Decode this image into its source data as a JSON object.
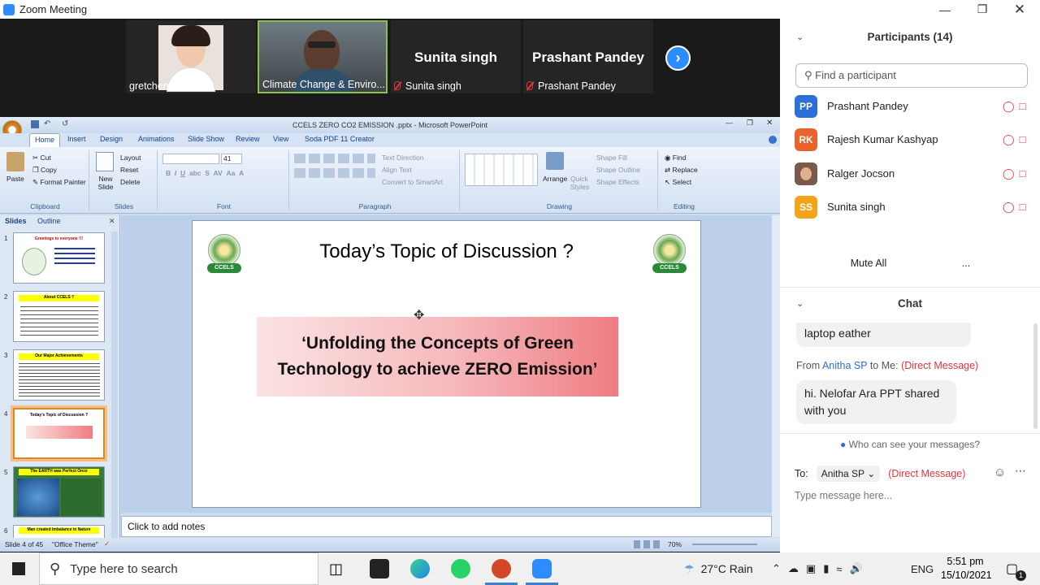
{
  "window": {
    "title": "Zoom Meeting",
    "controls": [
      "minimize-icon",
      "restore-icon",
      "close-icon"
    ]
  },
  "video_strip": {
    "tiles": [
      {
        "name": "gretchen liboon",
        "type": "video",
        "muted": false
      },
      {
        "name": "Climate Change & Enviro...",
        "type": "video",
        "muted": false,
        "active_speaker": true
      },
      {
        "name": "Sunita singh",
        "type": "name",
        "muted": true
      },
      {
        "name": "Prashant Pandey",
        "type": "name",
        "muted": true
      }
    ]
  },
  "powerpoint": {
    "title": "CCELS ZERO CO2 EMISSION .pptx - Microsoft PowerPoint",
    "tabs": [
      "Home",
      "Insert",
      "Design",
      "Animations",
      "Slide Show",
      "Review",
      "View",
      "Soda PDF 11 Creator"
    ],
    "ribbon": {
      "clipboard": {
        "paste": "Paste",
        "cut": "Cut",
        "copy": "Copy",
        "format_painter": "Format Painter",
        "label": "Clipboard"
      },
      "slides": {
        "new_slide": "New Slide",
        "layout": "Layout",
        "reset": "Reset",
        "delete": "Delete",
        "label": "Slides"
      },
      "font": {
        "size": "41",
        "label": "Font"
      },
      "paragraph": {
        "text_direction": "Text Direction",
        "align_text": "Align Text",
        "convert": "Convert to SmartArt",
        "label": "Paragraph"
      },
      "drawing": {
        "arrange": "Arrange",
        "quick_styles": "Quick Styles",
        "shape_fill": "Shape Fill",
        "shape_outline": "Shape Outline",
        "shape_effects": "Shape Effects",
        "label": "Drawing"
      },
      "editing": {
        "find": "Find",
        "replace": "Replace",
        "select": "Select",
        "label": "Editing"
      }
    },
    "panel_tabs": [
      "Slides",
      "Outline"
    ],
    "thumbnails": [
      {
        "num": "1",
        "title": "Greetings to everyone !!!"
      },
      {
        "num": "2",
        "title": "About CCELS ?"
      },
      {
        "num": "3",
        "title": "Our Major Achievements"
      },
      {
        "num": "4",
        "title": "Today's Topic of Discussion ?"
      },
      {
        "num": "5",
        "title": "The EARTH was Perfect Once"
      },
      {
        "num": "6",
        "title": "Man created Imbalance in Nature"
      }
    ],
    "slide": {
      "title": "Today’s Topic of Discussion ?",
      "logo_text": "CCELS",
      "banner_line1": "‘Unfolding the Concepts of Green",
      "banner_line2": "Technology to achieve ZERO Emission’"
    },
    "notes_placeholder": "Click to add notes",
    "status": {
      "slide": "Slide 4 of 45",
      "theme": "\"Office Theme\"",
      "zoom": "70%"
    }
  },
  "participants": {
    "header": "Participants (14)",
    "search_placeholder": "Find a participant",
    "list": [
      {
        "initials": "PP",
        "name": "Prashant Pandey",
        "color": "#2d6fd6"
      },
      {
        "initials": "RK",
        "name": "Rajesh Kumar Kashyap",
        "color": "#e8642a"
      },
      {
        "initials": "",
        "name": "Ralger Jocson",
        "color": "#7a5a48"
      },
      {
        "initials": "SS",
        "name": "Sunita singh",
        "color": "#f4a41a"
      }
    ],
    "mute_all": "Mute All",
    "more": "..."
  },
  "chat": {
    "header": "Chat",
    "bubble_partial": "laptop eather",
    "from_prefix": "From",
    "from_name": "Anitha SP",
    "from_suffix": "to Me:",
    "direct_tag": "(Direct Message)",
    "message_line1": "hi. Nelofar Ara PPT shared",
    "message_line2": "with you",
    "who_can_see": "Who can see your messages?",
    "to_label": "To:",
    "recipient": "Anitha SP",
    "placeholder": "Type message here..."
  },
  "taskbar": {
    "search_placeholder": "Type here to search",
    "weather": "27°C  Rain",
    "lang": "ENG",
    "time": "5:51 pm",
    "date": "15/10/2021",
    "notif_count": "1"
  }
}
